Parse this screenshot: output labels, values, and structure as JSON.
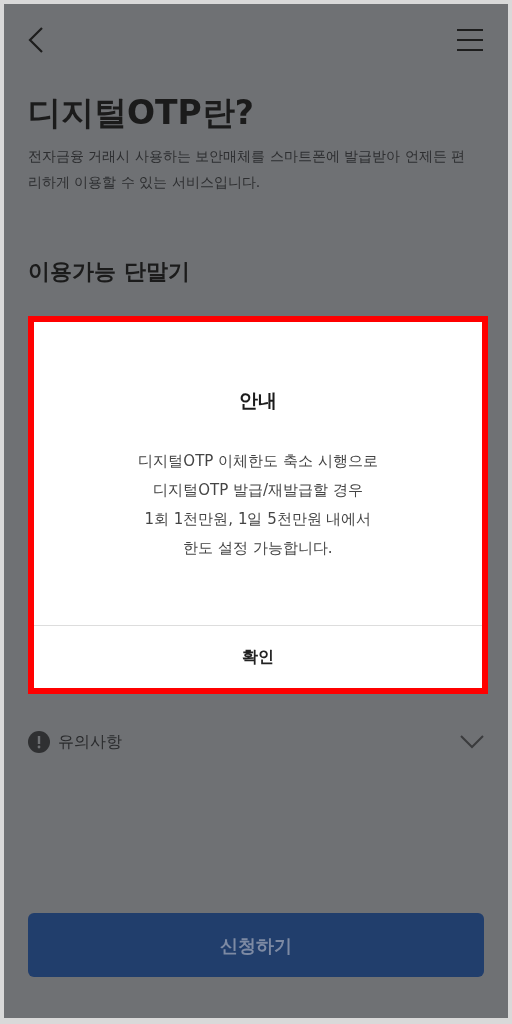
{
  "header": {
    "title": "디지털OTP란?",
    "description": "전자금융 거래시 사용하는 보안매체를 스마트폰에 발급받아 언제든 편리하게 이용할 수 있는 서비스입니다."
  },
  "section_title": "이용가능 단말기",
  "notice": {
    "label": "유의사항",
    "expanded": false
  },
  "apply_button": "신청하기",
  "dialog": {
    "title": "안내",
    "lines": [
      "디지털OTP 이체한도 축소 시행으로",
      "디지털OTP 발급/재발급할 경우",
      "1회 1천만원, 1일 5천만원 내에서",
      "한도 설정 가능합니다."
    ],
    "confirm": "확인"
  }
}
